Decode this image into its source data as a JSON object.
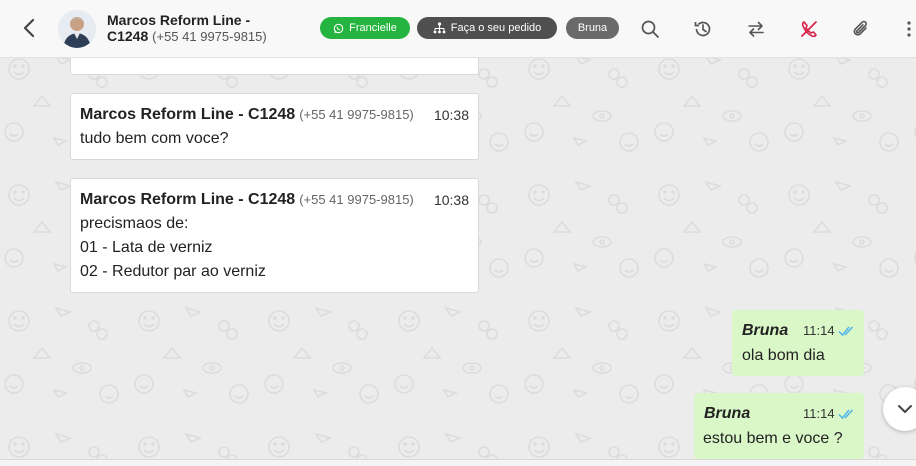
{
  "header": {
    "contact_name_line1": "Marcos Reform Line -",
    "contact_name_line2": "C1248",
    "contact_phone": "(+55 41 9975-9815)",
    "tags": [
      {
        "label": "Francielle",
        "color": "#25b43f"
      },
      {
        "label": "Faça o seu pedido",
        "color": "#4f4f4f"
      },
      {
        "label": "Bruna",
        "color": "#6a6a6a"
      }
    ],
    "icons": [
      "back-icon",
      "search-icon",
      "history-icon",
      "transfer-icon",
      "end-call-icon",
      "paperclip-icon",
      "more-vertical-icon"
    ]
  },
  "messages": [
    {
      "direction": "in",
      "sender": "Marcos Reform Line - C1248",
      "phone": "(+55 41 9975-9815)",
      "time": "10:38",
      "lines": [
        "tudo bem com voce?"
      ]
    },
    {
      "direction": "in",
      "sender": "Marcos Reform Line - C1248",
      "phone": "(+55 41 9975-9815)",
      "time": "10:38",
      "lines": [
        "precismaos de:",
        "01 - Lata de verniz",
        "02 - Redutor par ao verniz"
      ]
    },
    {
      "direction": "out",
      "sender": "Bruna",
      "time": "11:14",
      "lines": [
        "ola bom dia"
      ]
    },
    {
      "direction": "out",
      "sender": "Bruna",
      "time": "11:14",
      "lines": [
        "estou bem e voce ?"
      ]
    }
  ],
  "colors": {
    "outgoing_bubble": "#daf7c7",
    "read_ticks": "#4fb6ec",
    "end_call": "#d6214a"
  }
}
